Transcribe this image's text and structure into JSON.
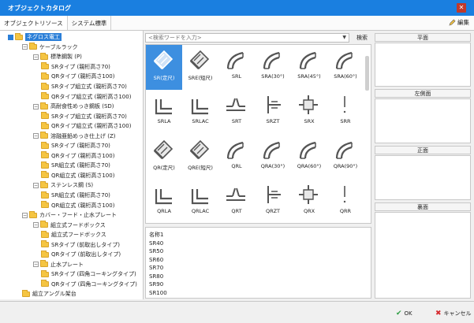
{
  "window": {
    "title": "オブジェクトカタログ",
    "close_glyph": "✕"
  },
  "tabs": [
    {
      "label": "オブジェクトリソース"
    },
    {
      "label": "システム標準"
    }
  ],
  "toolbar": {
    "edit_label": "編集",
    "edit_icon": "pencil-icon"
  },
  "tree": [
    {
      "label": "ネグロス電工",
      "indent": 1,
      "exp": "■",
      "selected": true
    },
    {
      "label": "ケーブルラック",
      "indent": 2,
      "exp": "⊟"
    },
    {
      "label": "標準鋼製 (P)",
      "indent": 3,
      "exp": "⊟"
    },
    {
      "label": "SRタイプ (親桁高さ70)",
      "indent": 4,
      "exp": ""
    },
    {
      "label": "QRタイプ (親桁高さ100)",
      "indent": 4,
      "exp": ""
    },
    {
      "label": "SRタイプ組立式 (親桁高さ70)",
      "indent": 4,
      "exp": ""
    },
    {
      "label": "QRタイプ組立式 (親桁高さ100)",
      "indent": 4,
      "exp": ""
    },
    {
      "label": "高耐食性めっき鋼板 (SD)",
      "indent": 3,
      "exp": "⊟"
    },
    {
      "label": "SRタイプ組立式 (親桁高さ70)",
      "indent": 4,
      "exp": ""
    },
    {
      "label": "QRタイプ組立式 (親桁高さ100)",
      "indent": 4,
      "exp": ""
    },
    {
      "label": "溶融亜鉛めっき仕上げ (Z)",
      "indent": 3,
      "exp": "⊟"
    },
    {
      "label": "SRタイプ (親桁高さ70)",
      "indent": 4,
      "exp": ""
    },
    {
      "label": "QRタイプ (親桁高さ100)",
      "indent": 4,
      "exp": ""
    },
    {
      "label": "SR組立式 (親桁高さ70)",
      "indent": 4,
      "exp": ""
    },
    {
      "label": "QR組立式 (親桁高さ100)",
      "indent": 4,
      "exp": ""
    },
    {
      "label": "ステンレス鋼 (S)",
      "indent": 3,
      "exp": "⊟"
    },
    {
      "label": "SR組立式 (親桁高さ70)",
      "indent": 4,
      "exp": ""
    },
    {
      "label": "QR組立式 (親桁高さ100)",
      "indent": 4,
      "exp": ""
    },
    {
      "label": "カバー・フード・止水プレート",
      "indent": 2,
      "exp": "⊟"
    },
    {
      "label": "組立式フードボックス",
      "indent": 3,
      "exp": "⊟"
    },
    {
      "label": "組立式フードボックス",
      "indent": 4,
      "exp": ""
    },
    {
      "label": "SRタイプ (前取出しタイプ)",
      "indent": 4,
      "exp": ""
    },
    {
      "label": "QRタイプ (前取出しタイプ)",
      "indent": 4,
      "exp": ""
    },
    {
      "label": "止水プレート",
      "indent": 3,
      "exp": "⊟"
    },
    {
      "label": "SRタイプ (四角コーキングタイプ)",
      "indent": 4,
      "exp": ""
    },
    {
      "label": "QRタイプ (四角コーキングタイプ)",
      "indent": 4,
      "exp": ""
    },
    {
      "label": "組立アングル架台",
      "indent": 2,
      "exp": ""
    }
  ],
  "search": {
    "placeholder": "<検索ワードを入力>",
    "dropdown_glyph": "▼",
    "button_label": "検索"
  },
  "parts": [
    {
      "label": "SR(定尺)",
      "icon": "straight-rack-icon",
      "selected": true
    },
    {
      "label": "SRE(短尺)",
      "icon": "straight-rack-icon"
    },
    {
      "label": "SRL",
      "icon": "elbow-icon"
    },
    {
      "label": "SRA(30°)",
      "icon": "elbow-icon"
    },
    {
      "label": "SRA(45°)",
      "icon": "elbow-icon"
    },
    {
      "label": "SRA(60°)",
      "icon": "elbow-icon"
    },
    {
      "label": "SRLA",
      "icon": "riser-icon"
    },
    {
      "label": "SRLAC",
      "icon": "riser-icon"
    },
    {
      "label": "SRT",
      "icon": "tee-icon"
    },
    {
      "label": "SRZT",
      "icon": "vertical-tee-icon"
    },
    {
      "label": "SRX",
      "icon": "cross-icon"
    },
    {
      "label": "SRR",
      "icon": "reducer-icon"
    },
    {
      "label": "QR(定尺)",
      "icon": "straight-rack-icon"
    },
    {
      "label": "QRE(短尺)",
      "icon": "straight-rack-icon"
    },
    {
      "label": "QRL",
      "icon": "elbow-icon"
    },
    {
      "label": "QRA(30°)",
      "icon": "elbow-icon"
    },
    {
      "label": "QRA(60°)",
      "icon": "elbow-icon"
    },
    {
      "label": "QRA(90°)",
      "icon": "elbow-icon"
    },
    {
      "label": "QRLA",
      "icon": "riser-icon"
    },
    {
      "label": "QRLAC",
      "icon": "riser-icon"
    },
    {
      "label": "QRT",
      "icon": "tee-icon"
    },
    {
      "label": "QRZT",
      "icon": "vertical-tee-icon"
    },
    {
      "label": "QRX",
      "icon": "cross-icon"
    },
    {
      "label": "QRR",
      "icon": "reducer-icon"
    }
  ],
  "property_list": {
    "header": "名称1",
    "items": [
      "SR40",
      "SR50",
      "SR60",
      "SR70",
      "SR80",
      "SR90",
      "SR100"
    ]
  },
  "views": {
    "top": "平面",
    "left": "左側面",
    "front": "正面",
    "back": "裏面"
  },
  "footer": {
    "ok_label": "OK",
    "cancel_label": "キャンセル",
    "ok_icon": "checkmark-icon",
    "cancel_icon": "x-icon"
  },
  "colors": {
    "titlebar": "#1a7fe0",
    "selection": "#3d8fe0",
    "folder": "#f5c542"
  }
}
